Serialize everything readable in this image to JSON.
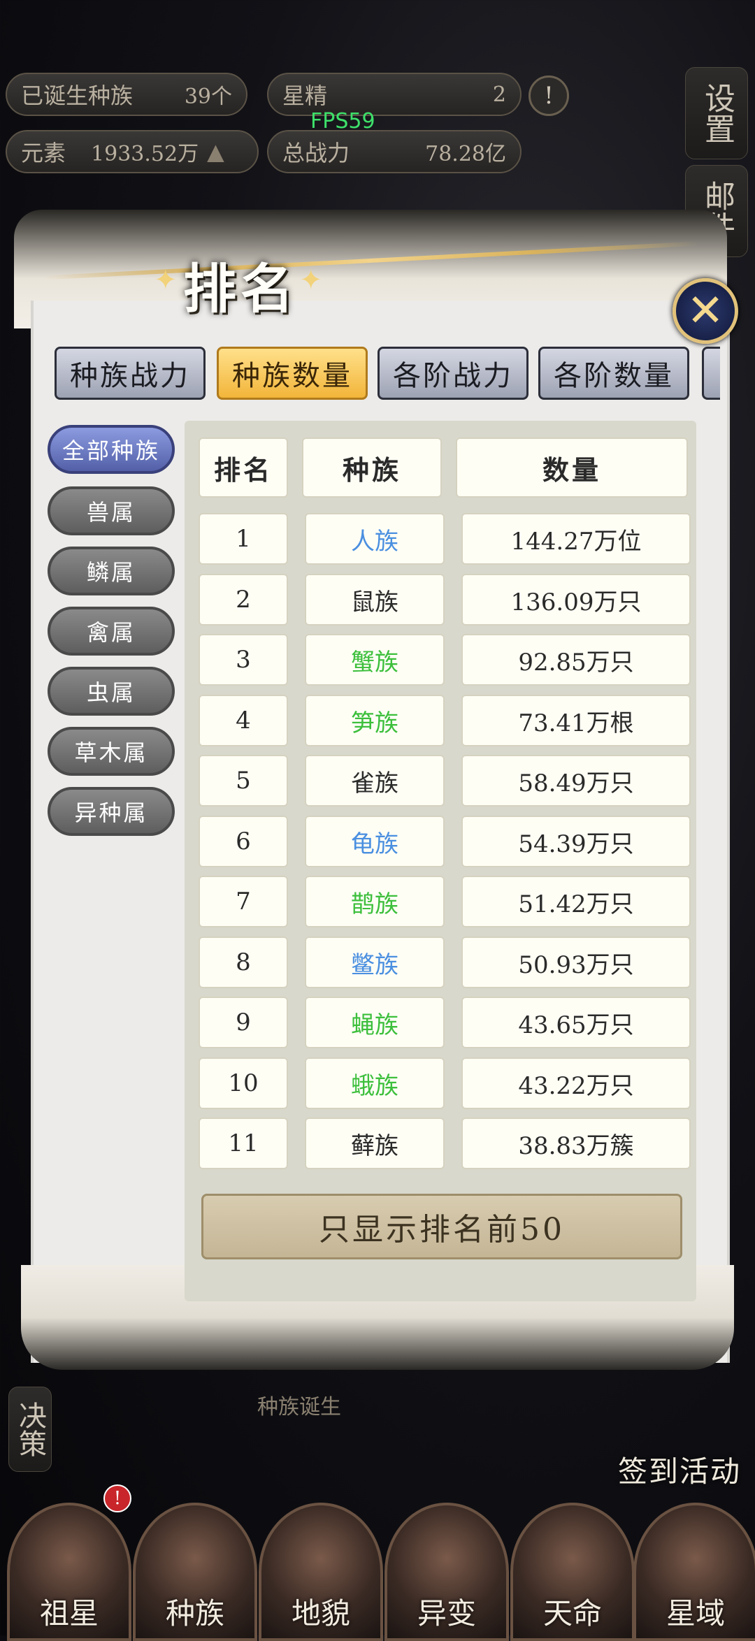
{
  "hud": {
    "born_label": "已诞生种族",
    "born_value": "39个",
    "star_label": "星精",
    "star_value": "2",
    "element_label": "元素",
    "element_value": "1933.52万",
    "power_label": "总战力",
    "power_value": "78.28亿",
    "fps": "FPS59"
  },
  "side_buttons": {
    "settings": "设置",
    "mail": "邮件",
    "decision": "决策"
  },
  "dialog": {
    "title": "排名",
    "tabs": [
      "种族战力",
      "种族数量",
      "各阶战力",
      "各阶数量"
    ],
    "active_tab": 1,
    "categories": [
      "全部种族",
      "兽属",
      "鳞属",
      "禽属",
      "虫属",
      "草木属",
      "异种属"
    ],
    "active_category": 0,
    "columns": [
      "排名",
      "种族",
      "数量"
    ],
    "rows": [
      {
        "rank": "1",
        "race": "人族",
        "count": "144.27万位",
        "color": "#4a8fe0"
      },
      {
        "rank": "2",
        "race": "鼠族",
        "count": "136.09万只",
        "color": "#2a2a2a"
      },
      {
        "rank": "3",
        "race": "蟹族",
        "count": "92.85万只",
        "color": "#3cbf3c"
      },
      {
        "rank": "4",
        "race": "笋族",
        "count": "73.41万根",
        "color": "#3cbf3c"
      },
      {
        "rank": "5",
        "race": "雀族",
        "count": "58.49万只",
        "color": "#2a2a2a"
      },
      {
        "rank": "6",
        "race": "龟族",
        "count": "54.39万只",
        "color": "#4a8fe0"
      },
      {
        "rank": "7",
        "race": "鹊族",
        "count": "51.42万只",
        "color": "#3cbf3c"
      },
      {
        "rank": "8",
        "race": "鳖族",
        "count": "50.93万只",
        "color": "#4a8fe0"
      },
      {
        "rank": "9",
        "race": "蝇族",
        "count": "43.65万只",
        "color": "#3cbf3c"
      },
      {
        "rank": "10",
        "race": "蛾族",
        "count": "43.22万只",
        "color": "#3cbf3c"
      },
      {
        "rank": "11",
        "race": "藓族",
        "count": "38.83万簇",
        "color": "#2a2a2a"
      }
    ],
    "footer_button": "只显示排名前50",
    "close_label": "✕"
  },
  "below": {
    "caption": "种族诞生",
    "checkin": "签到活动"
  },
  "nav": [
    "祖星",
    "种族",
    "地貌",
    "异变",
    "天命",
    "星域"
  ],
  "nav_badge": "!"
}
